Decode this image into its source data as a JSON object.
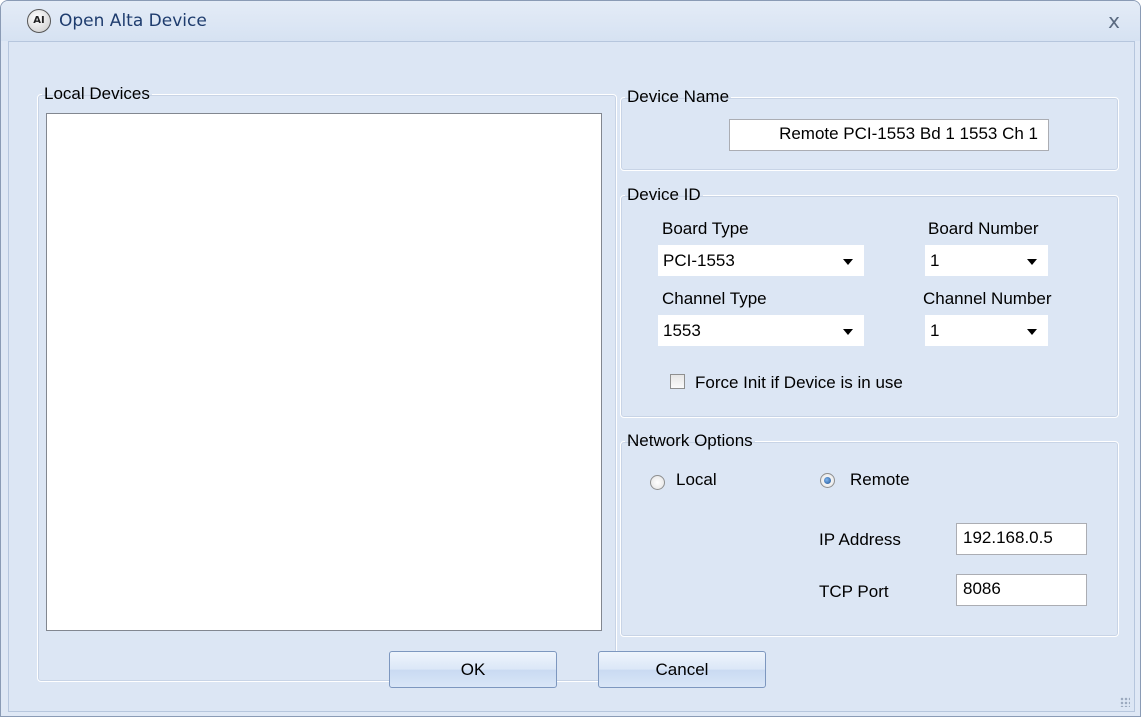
{
  "window": {
    "title": "Open Alta Device",
    "icon": "alta-logo-icon",
    "close_glyph": "x"
  },
  "local_devices": {
    "legend": "Local Devices",
    "items": []
  },
  "device_name": {
    "legend": "Device Name",
    "value": "Remote PCI-1553 Bd 1 1553 Ch 1"
  },
  "device_id": {
    "legend": "Device ID",
    "board_type_label": "Board Type",
    "board_type_value": "PCI-1553",
    "board_number_label": "Board Number",
    "board_number_value": "1",
    "channel_type_label": "Channel Type",
    "channel_type_value": "1553",
    "channel_number_label": "Channel Number",
    "channel_number_value": "1",
    "force_init_label": "Force Init if Device is in use",
    "force_init_checked": false
  },
  "network": {
    "legend": "Network Options",
    "local_label": "Local",
    "remote_label": "Remote",
    "selected": "Remote",
    "ip_label": "IP Address",
    "ip_value": "192.168.0.5",
    "port_label": "TCP Port",
    "port_value": "8086"
  },
  "buttons": {
    "ok": "OK",
    "cancel": "Cancel"
  },
  "colors": {
    "client_bg": "#dce6f4",
    "title_text": "#1e3c6e",
    "button_border": "#7d97bf"
  }
}
